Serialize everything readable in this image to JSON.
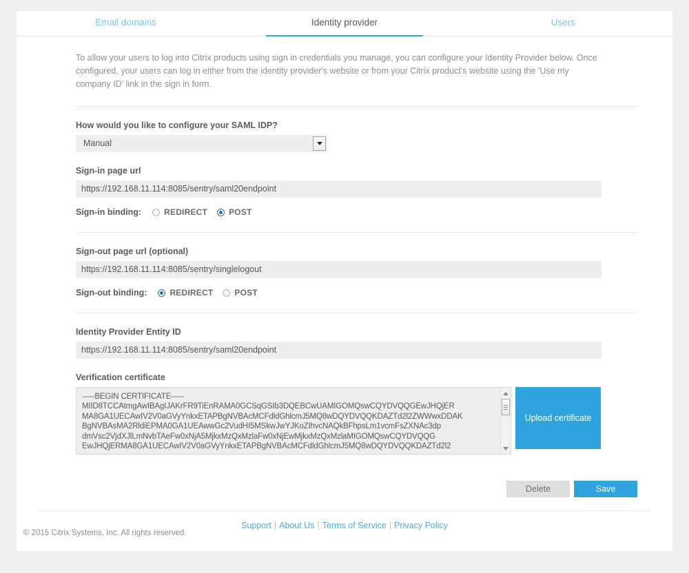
{
  "tabs": [
    {
      "label": "Email domains",
      "active": false
    },
    {
      "label": "Identity provider",
      "active": true
    },
    {
      "label": "Users",
      "active": false
    }
  ],
  "intro": "To allow your users to log into Citrix products using sign in credentials you manage, you can configure your Identity Provider below. Once configured, your users can log in either from the identity provider's website or from your Citrix product's website using the 'Use my company ID' link in the sign in form.",
  "form": {
    "saml_idp_question": "How would you like to configure your SAML IDP?",
    "saml_idp_value": "Manual",
    "signin_url_label": "Sign-in page url",
    "signin_url_value": "https://192.168.11.114:8085/sentry/saml20endpoint",
    "signin_binding_label": "Sign-in binding:",
    "signin_binding_options": [
      {
        "label": "REDIRECT",
        "selected": false
      },
      {
        "label": "POST",
        "selected": true
      }
    ],
    "signout_url_label": "Sign-out page url (optional)",
    "signout_url_value": "https://192.168.11.114:8085/sentry/singlelogout",
    "signout_binding_label": "Sign-out binding:",
    "signout_binding_options": [
      {
        "label": "REDIRECT",
        "selected": true
      },
      {
        "label": "POST",
        "selected": false
      }
    ],
    "entity_id_label": "Identity Provider Entity ID",
    "entity_id_value": "https://192.168.11.114:8085/sentry/saml20endpoint",
    "certificate_label": "Verification certificate",
    "certificate_value": "-----BEGIN CERTIFICATE-----\nMIID8TCCAtmgAwIBAgIJAKrFR9TiEnRAMA0GCSqGSIb3DQEBCwUAMIGOMQswCQYDVQQGEwJHQjER\nMA8GA1UECAwIV2V0aGVyYnkxETAPBgNVBAcMCFdldGhlcmJ5MQ8wDQYDVQQKDAZTd2l2ZWWwxDDAK\nBgNVBAsMA2RldiEPMA0GA1UEAwwGc2VudHI5MSkwJwYJKoZIhvcNAQkBFhpsLm1vcmFsZXNAc3dp\ndmVsc2VjdXJlLmNvbTAeFw0xNjA5MjkxMzQxMzlaFw0xNjEwMjkxMzQxMzlaMIGOMQswCQYDVQQG\nEwJHQjERMA8GA1UECAwIV2V0aGVyYnkxETAPBgNVBAcMCFdldGhlcmJ5MQ8wDQYDVQQKDAZTd2l2",
    "upload_certificate_label": "Upload certificate",
    "delete_label": "Delete",
    "save_label": "Save"
  },
  "footer": {
    "links": [
      "Support",
      "About Us",
      "Terms of Service",
      "Privacy Policy"
    ],
    "separator": "|",
    "copyright": "© 2015 Citrix Systems, Inc. All rights reserved."
  },
  "colors": {
    "accent": "#2ea3dd",
    "tab_inactive": "#7ec5ea",
    "field_bg": "#eeeeee"
  }
}
